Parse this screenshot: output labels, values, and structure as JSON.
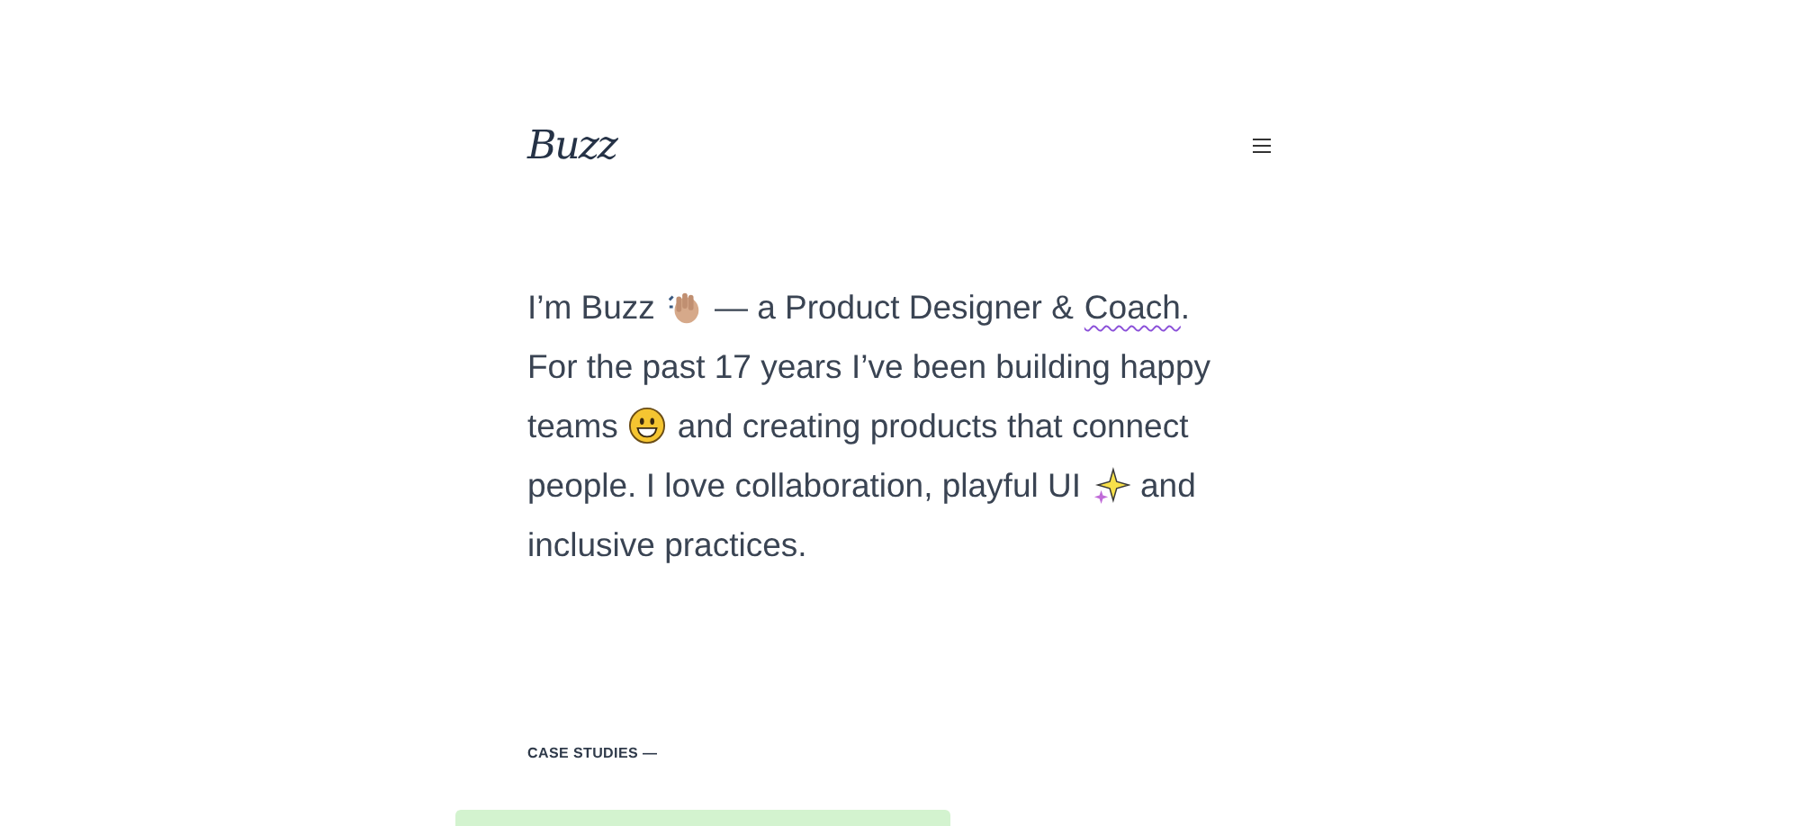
{
  "header": {
    "logo": "Buzz"
  },
  "intro": [
    [
      {
        "kind": "text",
        "text": "I’m Buzz"
      },
      {
        "kind": "icon"
      },
      {
        "kind": "text",
        "text": "— a Product Designer &"
      },
      {
        "kind": "link",
        "text": "Coach"
      },
      {
        "kind": "text",
        "text": "."
      }
    ],
    [
      {
        "kind": "text",
        "text": "For the past 17 years I’ve been building happy"
      }
    ],
    [
      {
        "kind": "text",
        "text": "teams"
      },
      {
        "kind": "icon"
      },
      {
        "kind": "text",
        "text": "and creating products that connect"
      }
    ],
    [
      {
        "kind": "text",
        "text": "people. I love collaboration, playful UI"
      },
      {
        "kind": "icon"
      },
      {
        "kind": "text",
        "text": "and"
      }
    ],
    [
      {
        "kind": "text",
        "text": "inclusive practices."
      }
    ]
  ],
  "case_studies": {
    "heading": "CASE STUDIES —"
  }
}
